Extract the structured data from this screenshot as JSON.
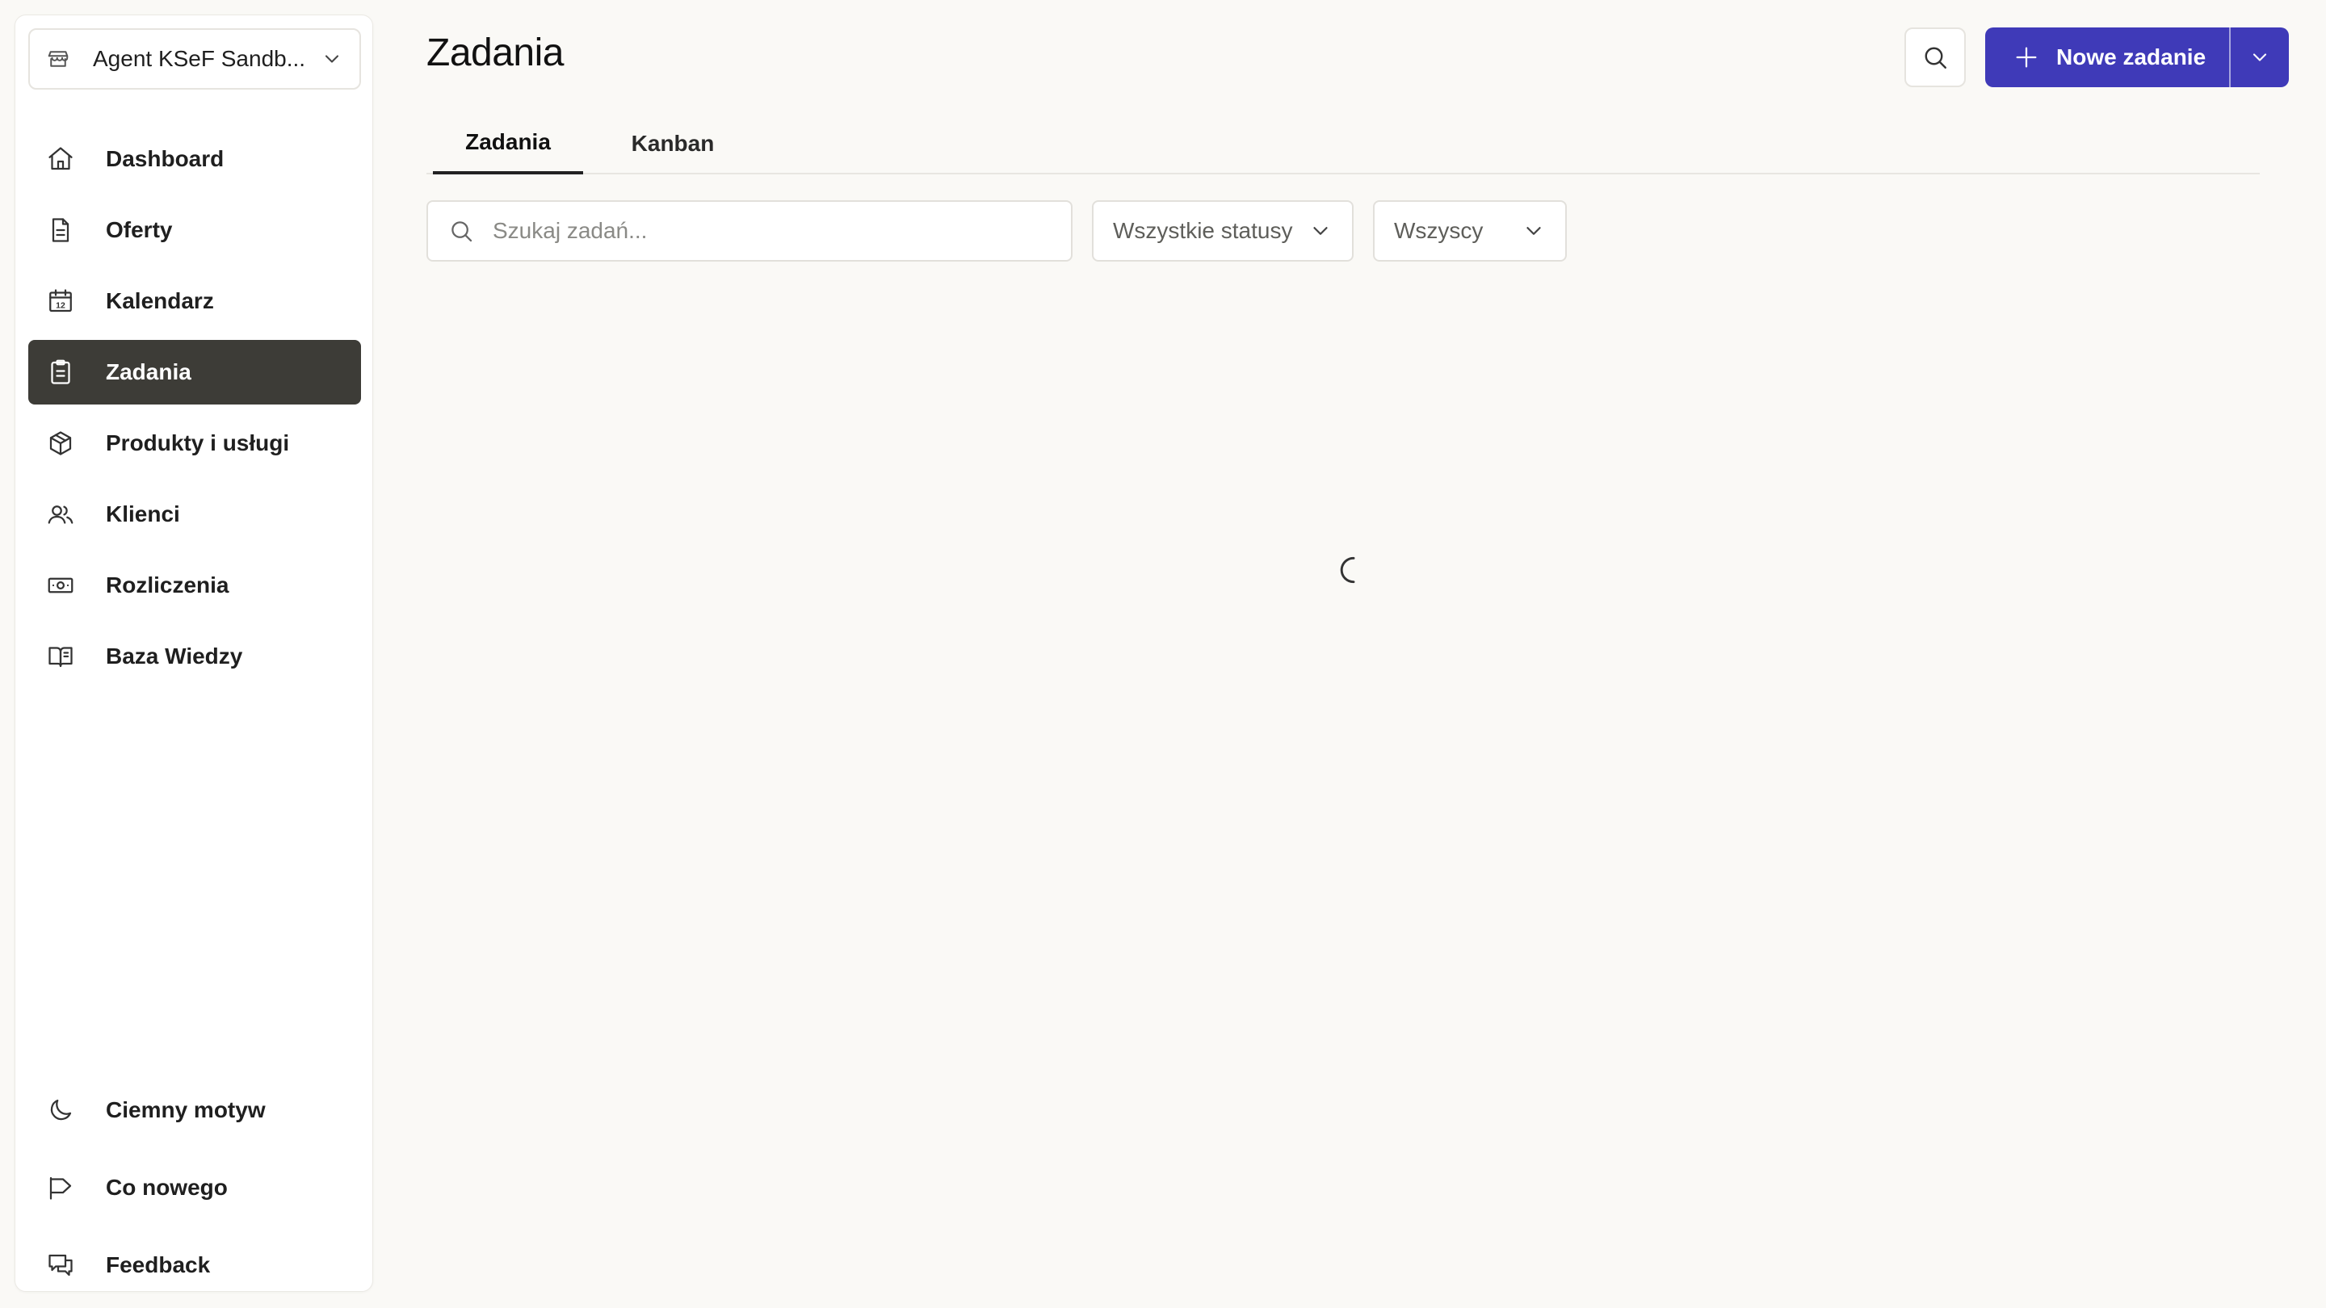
{
  "workspace": {
    "name": "Agent KSeF Sandb..."
  },
  "sidebar": {
    "items": [
      {
        "label": "Dashboard",
        "icon": "home-icon"
      },
      {
        "label": "Oferty",
        "icon": "document-icon"
      },
      {
        "label": "Kalendarz",
        "icon": "calendar-icon",
        "badge": "12"
      },
      {
        "label": "Zadania",
        "icon": "clipboard-icon",
        "active": true
      },
      {
        "label": "Produkty i usługi",
        "icon": "box-icon"
      },
      {
        "label": "Klienci",
        "icon": "users-icon"
      },
      {
        "label": "Rozliczenia",
        "icon": "banknote-icon"
      },
      {
        "label": "Baza Wiedzy",
        "icon": "book-icon"
      }
    ],
    "bottom": [
      {
        "label": "Ciemny motyw",
        "icon": "moon-icon"
      },
      {
        "label": "Co nowego",
        "icon": "megaphone-icon"
      },
      {
        "label": "Feedback",
        "icon": "chat-icon"
      }
    ]
  },
  "header": {
    "title": "Zadania",
    "new_button": "Nowe zadanie"
  },
  "tabs": [
    {
      "label": "Zadania",
      "active": true
    },
    {
      "label": "Kanban"
    }
  ],
  "filters": {
    "search_placeholder": "Szukaj zadań...",
    "status": "Wszystkie statusy",
    "assignee": "Wszyscy"
  },
  "colors": {
    "accent": "#3f3ab8",
    "active_nav": "#3d3c37",
    "background": "#faf9f6"
  }
}
